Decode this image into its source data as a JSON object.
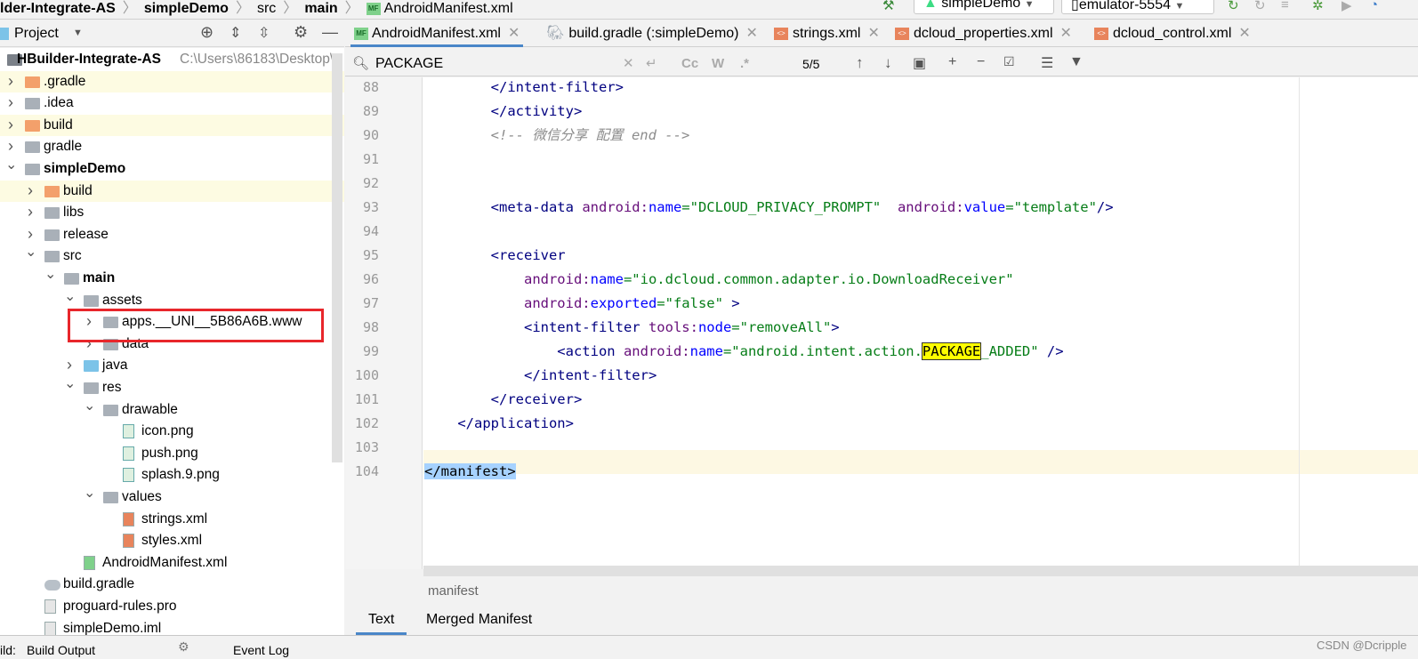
{
  "breadcrumbs": [
    "lder-Integrate-AS",
    "simpleDemo",
    "src",
    "main",
    "AndroidManifest.xml"
  ],
  "run_config": "simpleDemo",
  "device": "emulator-5554",
  "project_panel": {
    "title": "Project"
  },
  "tree": [
    {
      "label": "HBuilder-Integrate-AS",
      "path": "C:\\Users\\86183\\Desktop\\",
      "level": -1,
      "bold": true,
      "icon": "module-folder-icon"
    },
    {
      "label": ".gradle",
      "level": 0,
      "arrow": "collapsed",
      "icon": "folder-icon",
      "color": "orange",
      "hl": true
    },
    {
      "label": ".idea",
      "level": 0,
      "arrow": "collapsed",
      "icon": "folder-icon",
      "color": "gray"
    },
    {
      "label": "build",
      "level": 0,
      "arrow": "collapsed",
      "icon": "folder-icon",
      "color": "orange",
      "hl": true
    },
    {
      "label": "gradle",
      "level": 0,
      "arrow": "collapsed",
      "icon": "folder-icon",
      "color": "gray"
    },
    {
      "label": "simpleDemo",
      "level": 0,
      "arrow": "expanded",
      "icon": "module-folder-icon",
      "color": "gray",
      "bold": true
    },
    {
      "label": "build",
      "level": 1,
      "arrow": "collapsed",
      "icon": "folder-icon",
      "color": "orange",
      "hl": true
    },
    {
      "label": "libs",
      "level": 1,
      "arrow": "collapsed",
      "icon": "folder-icon",
      "color": "gray"
    },
    {
      "label": "release",
      "level": 1,
      "arrow": "collapsed",
      "icon": "folder-icon",
      "color": "gray"
    },
    {
      "label": "src",
      "level": 1,
      "arrow": "expanded",
      "icon": "folder-icon",
      "color": "gray"
    },
    {
      "label": "main",
      "level": 2,
      "arrow": "expanded",
      "icon": "folder-icon",
      "color": "gray",
      "bold": true
    },
    {
      "label": "assets",
      "level": 3,
      "arrow": "expanded",
      "icon": "folder-icon",
      "color": "gray"
    },
    {
      "label": "apps.__UNI__5B86A6B.www",
      "level": 4,
      "arrow": "collapsed",
      "icon": "folder-icon",
      "color": "gray",
      "boxed": true
    },
    {
      "label": "data",
      "level": 4,
      "arrow": "collapsed",
      "icon": "folder-icon",
      "color": "gray"
    },
    {
      "label": "java",
      "level": 3,
      "arrow": "collapsed",
      "icon": "folder-icon",
      "color": "blue"
    },
    {
      "label": "res",
      "level": 3,
      "arrow": "expanded",
      "icon": "folder-icon",
      "color": "gray"
    },
    {
      "label": "drawable",
      "level": 4,
      "arrow": "expanded",
      "icon": "folder-icon",
      "color": "gray"
    },
    {
      "label": "icon.png",
      "level": 5,
      "icon": "image-file-icon"
    },
    {
      "label": "push.png",
      "level": 5,
      "icon": "image-file-icon"
    },
    {
      "label": "splash.9.png",
      "level": 5,
      "icon": "image-file-icon"
    },
    {
      "label": "values",
      "level": 4,
      "arrow": "expanded",
      "icon": "folder-icon",
      "color": "gray"
    },
    {
      "label": "strings.xml",
      "level": 5,
      "icon": "xml-file-icon"
    },
    {
      "label": "styles.xml",
      "level": 5,
      "icon": "xml-file-icon"
    },
    {
      "label": "AndroidManifest.xml",
      "level": 3,
      "icon": "manifest-file-icon"
    },
    {
      "label": "build.gradle",
      "level": 1,
      "icon": "gradle-file-icon"
    },
    {
      "label": "proguard-rules.pro",
      "level": 1,
      "icon": "text-file-icon"
    },
    {
      "label": "simpleDemo.iml",
      "level": 1,
      "icon": "iml-file-icon"
    }
  ],
  "tabs": [
    {
      "label": "AndroidManifest.xml",
      "icon": "manifest-file-icon",
      "active": true
    },
    {
      "label": "build.gradle (:simpleDemo)",
      "icon": "gradle-file-icon"
    },
    {
      "label": "strings.xml",
      "icon": "xml-file-icon"
    },
    {
      "label": "dcloud_properties.xml",
      "icon": "xml-file-icon"
    },
    {
      "label": "dcloud_control.xml",
      "icon": "xml-file-icon"
    }
  ],
  "search": {
    "query": "PACKAGE",
    "match_count": "5/5",
    "cc": "Cc",
    "w": "W",
    "regex": ".*"
  },
  "code": [
    {
      "n": "88",
      "segs": [
        [
          "        </intent-filter>",
          "tag"
        ]
      ]
    },
    {
      "n": "89",
      "segs": [
        [
          "        </activity>",
          "tag"
        ]
      ]
    },
    {
      "n": "90",
      "segs": [
        [
          "        <!-- 微信分享 配置 end -->",
          "cm"
        ]
      ]
    },
    {
      "n": "91",
      "segs": []
    },
    {
      "n": "92",
      "segs": []
    },
    {
      "n": "93",
      "segs": [
        [
          "        <meta-data ",
          "tag"
        ],
        [
          "android:",
          "attrns"
        ],
        [
          "name",
          "attr"
        ],
        [
          "=\"DCLOUD_PRIVACY_PROMPT\"",
          "str"
        ],
        [
          "  ",
          "pun"
        ],
        [
          "android:",
          "attrns"
        ],
        [
          "value",
          "attr"
        ],
        [
          "=\"template\"",
          "str"
        ],
        [
          "/>",
          "tag"
        ]
      ]
    },
    {
      "n": "94",
      "segs": []
    },
    {
      "n": "95",
      "segs": [
        [
          "        <receiver",
          "tag"
        ]
      ]
    },
    {
      "n": "96",
      "segs": [
        [
          "            ",
          "pun"
        ],
        [
          "android:",
          "attrns"
        ],
        [
          "name",
          "attr"
        ],
        [
          "=\"io.dcloud.common.adapter.io.DownloadReceiver\"",
          "str"
        ]
      ]
    },
    {
      "n": "97",
      "segs": [
        [
          "            ",
          "pun"
        ],
        [
          "android:",
          "attrns"
        ],
        [
          "exported",
          "attr"
        ],
        [
          "=\"false\"",
          "str"
        ],
        [
          " >",
          "tag"
        ]
      ]
    },
    {
      "n": "98",
      "segs": [
        [
          "            <intent-filter ",
          "tag"
        ],
        [
          "tools:",
          "attrns"
        ],
        [
          "node",
          "attr"
        ],
        [
          "=\"removeAll\"",
          "str"
        ],
        [
          ">",
          "tag"
        ]
      ]
    },
    {
      "n": "99",
      "segs": [
        [
          "                <action ",
          "tag"
        ],
        [
          "android:",
          "attrns"
        ],
        [
          "name",
          "attr"
        ],
        [
          "=\"android.intent.action.",
          "str"
        ],
        [
          "PACKAGE",
          "match"
        ],
        [
          "_ADDED\"",
          "str"
        ],
        [
          " />",
          "tag"
        ]
      ]
    },
    {
      "n": "100",
      "segs": [
        [
          "            </intent-filter>",
          "tag"
        ]
      ]
    },
    {
      "n": "101",
      "segs": [
        [
          "        </receiver>",
          "tag"
        ]
      ]
    },
    {
      "n": "102",
      "segs": [
        [
          "    </application>",
          "tag"
        ]
      ]
    },
    {
      "n": "103",
      "segs": []
    },
    {
      "n": "104",
      "segs": [
        [
          "</manifest>",
          "selbg"
        ]
      ]
    }
  ],
  "editor_breadcrumb": "manifest",
  "bottom_tabs": [
    {
      "label": "Text",
      "active": true
    },
    {
      "label": "Merged Manifest"
    }
  ],
  "status_bar": {
    "left": "ild:",
    "build_output": "Build Output",
    "event_log": "Event Log"
  },
  "watermark": "CSDN @Dcripple",
  "colors": {
    "accent": "#4a86c8",
    "match_highlight": "#ffff00",
    "annotation_box": "#e8262b"
  }
}
